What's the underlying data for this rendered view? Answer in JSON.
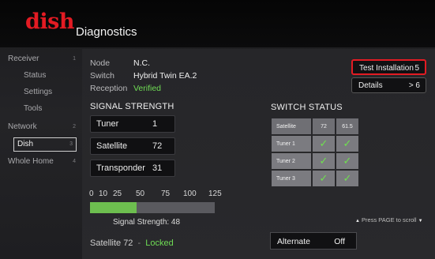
{
  "header": {
    "logo_text": "dish",
    "title": "Diagnostics",
    "brand_color": "#e31b23"
  },
  "sidebar": {
    "items": [
      {
        "label": "Receiver",
        "number": "1"
      },
      {
        "label": "Status",
        "number": ""
      },
      {
        "label": "Settings",
        "number": ""
      },
      {
        "label": "Tools",
        "number": ""
      },
      {
        "label": "Network",
        "number": "2"
      },
      {
        "label": "Dish",
        "number": "3",
        "selected": true
      },
      {
        "label": "Whole Home",
        "number": "4"
      }
    ]
  },
  "info": {
    "node_label": "Node",
    "node_value": "N.C.",
    "switch_label": "Switch",
    "switch_value": "Hybrid Twin EA.2",
    "reception_label": "Reception",
    "reception_value": "Verified"
  },
  "signal": {
    "title": "SIGNAL STRENGTH",
    "tuner_label": "Tuner",
    "tuner_value": "1",
    "satellite_label": "Satellite",
    "satellite_value": "72",
    "transponder_label": "Transponder",
    "transponder_value": "31",
    "scale_ticks": [
      "0",
      "10",
      "25",
      "50",
      "75",
      "100",
      "125"
    ],
    "strength": 48,
    "strength_max": 125,
    "strength_text": "Signal Strength: 48",
    "locked_prefix": "Satellite 72",
    "locked_sep": "-",
    "locked_status": "Locked"
  },
  "buttons": {
    "test_label": "Test Installation",
    "test_key": "5",
    "details_label": "Details",
    "details_key": "> 6"
  },
  "switch_status": {
    "title": "SWITCH STATUS",
    "header": [
      "Satellite",
      "72",
      "61.5"
    ],
    "rows": [
      {
        "label": "Tuner 1",
        "a": "✓",
        "b": "✓"
      },
      {
        "label": "Tuner 2",
        "a": "✓",
        "b": "✓"
      },
      {
        "label": "Tuner 3",
        "a": "✓",
        "b": "✓"
      }
    ]
  },
  "scroll_hint": {
    "up": "▲",
    "text": "Press PAGE to scroll",
    "down": "▼"
  },
  "alternate": {
    "label": "Alternate",
    "value": "Off"
  }
}
